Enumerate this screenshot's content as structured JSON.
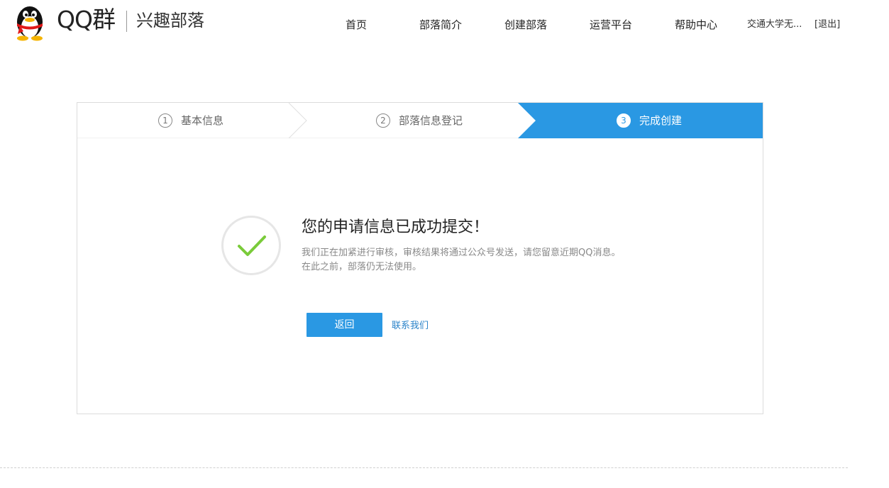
{
  "header": {
    "logo_text": "QQ群",
    "logo_subtitle": "兴趣部落",
    "nav": [
      {
        "label": "首页"
      },
      {
        "label": "部落简介"
      },
      {
        "label": "创建部落"
      },
      {
        "label": "运营平台"
      },
      {
        "label": "帮助中心"
      }
    ],
    "user_name": "交通大学无...",
    "logout_label": "[退出]"
  },
  "steps": [
    {
      "number": "1",
      "label": "基本信息",
      "active": false
    },
    {
      "number": "2",
      "label": "部落信息登记",
      "active": false
    },
    {
      "number": "3",
      "label": "完成创建",
      "active": true
    }
  ],
  "result": {
    "title": "您的申请信息已成功提交！",
    "line1": "我们正在加紧进行审核，审核结果将通过公众号发送，请您留意近期QQ消息。",
    "line2": "在此之前，部落仍无法使用。",
    "back_button": "返回",
    "contact_link": "联系我们"
  },
  "colors": {
    "accent": "#2a98e3",
    "check": "#7acb3a",
    "link": "#2a83c9"
  },
  "icons": {
    "logo": "qq-penguin-icon",
    "success": "checkmark-icon"
  }
}
